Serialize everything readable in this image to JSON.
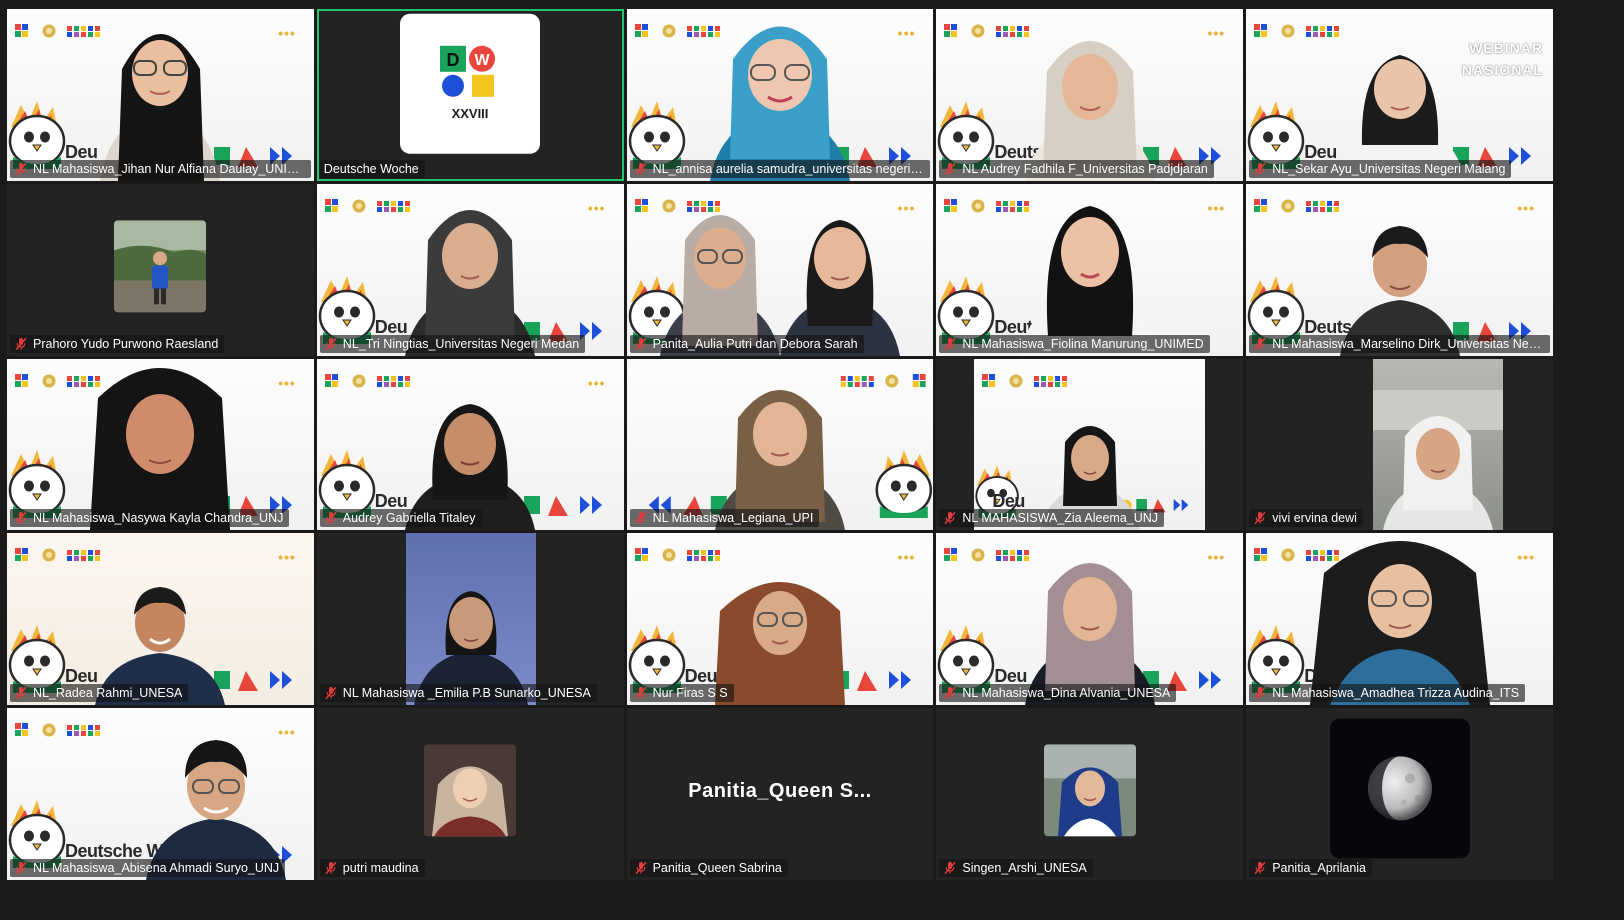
{
  "meeting": {
    "active_speaker_index": 1,
    "accent_color": "#22c56b",
    "muted_icon": "mic-muted-icon",
    "participants": [
      {
        "name": "NL Mahasiswa_Jihan Nur Alfiana Daulay_UNIMED",
        "muted": true,
        "view": "video"
      },
      {
        "name": "Deutsche Woche",
        "muted": false,
        "view": "logo",
        "logo_text": [
          "D",
          "W",
          "XXVIII"
        ]
      },
      {
        "name": "NL_annisa aurelia samudra_universitas negeri ma...",
        "muted": true,
        "view": "video"
      },
      {
        "name": "NL Audrey Fadhila F_Universitas Padjdjaran",
        "muted": true,
        "view": "video"
      },
      {
        "name": "NL_Sekar Ayu_Universitas Negeri Malang",
        "muted": true,
        "view": "video",
        "overlay_text": [
          "WEBINAR",
          "NASIONAL"
        ]
      },
      {
        "name": "Prahoro Yudo Purwono Raesland",
        "muted": true,
        "view": "avatar-photo"
      },
      {
        "name": "NL_Tri Ningtias_Universitas Negeri Medan",
        "muted": true,
        "view": "video"
      },
      {
        "name": "Panita_Aulia Putri dan Debora Sarah",
        "muted": true,
        "view": "video"
      },
      {
        "name": "NL Mahasiswa_Fiolina Manurung_UNIMED",
        "muted": true,
        "view": "video"
      },
      {
        "name": "NL Mahasiswa_Marselino Dirk_Universitas Negeri...",
        "muted": true,
        "view": "video"
      },
      {
        "name": "NL Mahasiswa_Nasywa Kayla Chandra_UNJ",
        "muted": true,
        "view": "video"
      },
      {
        "name": "Audrey Gabriella Titaley",
        "muted": true,
        "view": "video"
      },
      {
        "name": "NL Mahasiswa_Legiana_UPI",
        "muted": true,
        "view": "video"
      },
      {
        "name": "NL MAHASISWA_Zia Aleema_UNJ",
        "muted": true,
        "view": "video-narrow"
      },
      {
        "name": "vivi ervina dewi",
        "muted": true,
        "view": "video-narrow"
      },
      {
        "name": "NL_Radea Rahmi_UNESA",
        "muted": true,
        "view": "video"
      },
      {
        "name": "NL Mahasiswa _Emilia P.B Sunarko_UNESA",
        "muted": true,
        "view": "video-narrow"
      },
      {
        "name": "Nur Firas S S",
        "muted": true,
        "view": "video"
      },
      {
        "name": "NL Mahasiswa_Dina Alvania_UNESA",
        "muted": true,
        "view": "video"
      },
      {
        "name": "NL Mahasiswa_Amadhea Trizza Audina_ITS",
        "muted": true,
        "view": "video"
      },
      {
        "name": "NL Mahasiswa_Abisena Ahmadi Suryo_UNJ",
        "muted": true,
        "view": "video"
      },
      {
        "name": "putri maudina",
        "muted": true,
        "view": "avatar-photo"
      },
      {
        "name": "Panitia_Queen Sabrina",
        "muted": true,
        "view": "text-avatar",
        "avatar_text": "Panitia_Queen  S..."
      },
      {
        "name": "Singen_Arshi_UNESA",
        "muted": true,
        "view": "avatar-photo"
      },
      {
        "name": "Panitia_Aprilania",
        "muted": true,
        "view": "avatar-large"
      }
    ]
  },
  "background": {
    "brand_text": "Deutsche Woche",
    "brand_short": "Deu",
    "dots": "•••"
  }
}
